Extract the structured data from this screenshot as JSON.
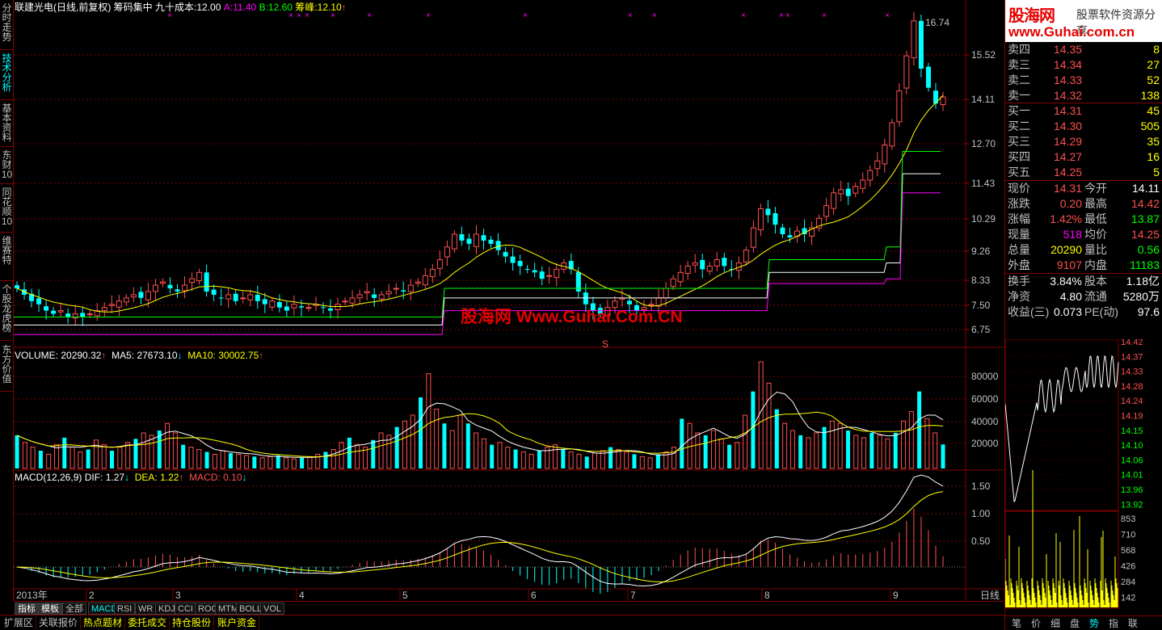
{
  "header": {
    "stock_name": "联建光电(日线,前复权)",
    "indicator_name": "筹码集中",
    "cost90_label": "九十成本:",
    "cost90_value": "12.00",
    "a_label": "A:",
    "a_value": "11.40",
    "b_label": "B:",
    "b_value": "12.60",
    "peak_label": "筹峰:",
    "peak_value": "12.10",
    "peak_arrow": "↑"
  },
  "left_tabs": [
    {
      "label": "分时走势",
      "active": false
    },
    {
      "label": "技术分析",
      "active": true
    },
    {
      "label": "基本资料",
      "active": false
    },
    {
      "label": "东财10",
      "active": false
    },
    {
      "label": "同花顺10",
      "active": false
    },
    {
      "label": "维赛特",
      "active": false
    },
    {
      "label": "个股龙虎榜",
      "active": false
    },
    {
      "label": "东方价值",
      "active": false
    }
  ],
  "price_axis": [
    "15.52",
    "14.11",
    "12.70",
    "11.43",
    "10.29",
    "9.26",
    "8.33",
    "7.50",
    "6.75"
  ],
  "high_label": "16.74",
  "s_marker": "S",
  "volume": {
    "label": "VOLUME:",
    "value": "20290.32",
    "ma5_label": "MA5:",
    "ma5_value": "27673.10",
    "ma10_label": "MA10:",
    "ma10_value": "30002.75",
    "axis": [
      "80000",
      "60000",
      "40000",
      "20000"
    ]
  },
  "macd": {
    "label": "MACD(12,26,9)",
    "dif_label": "DIF:",
    "dif_value": "1.27",
    "dea_label": "DEA:",
    "dea_value": "1.22",
    "macd_label": "MACD:",
    "macd_value": "0.10",
    "axis": [
      "1.50",
      "1.00",
      "0.50"
    ]
  },
  "time_axis": [
    "2013年",
    "2",
    "3",
    "4",
    "5",
    "6",
    "7",
    "8",
    "9"
  ],
  "period_label": "日线",
  "watermark": "股海网 Www.Guhai.Com.CN",
  "logo": {
    "main": "股海网",
    "sub": "股票软件资源分享",
    "url": "www.Guhai.com.cn"
  },
  "order_book": {
    "sells": [
      {
        "label": "卖四",
        "price": "14.35",
        "vol": "8"
      },
      {
        "label": "卖三",
        "price": "14.34",
        "vol": "27"
      },
      {
        "label": "卖二",
        "price": "14.33",
        "vol": "52"
      },
      {
        "label": "卖一",
        "price": "14.32",
        "vol": "138"
      }
    ],
    "buys": [
      {
        "label": "买一",
        "price": "14.31",
        "vol": "45"
      },
      {
        "label": "买二",
        "price": "14.30",
        "vol": "505"
      },
      {
        "label": "买三",
        "price": "14.29",
        "vol": "35"
      },
      {
        "label": "买四",
        "price": "14.27",
        "vol": "16"
      },
      {
        "label": "买五",
        "price": "14.25",
        "vol": "5"
      }
    ]
  },
  "quote": [
    {
      "l1": "现价",
      "v1": "14.31",
      "c1": "#ff5050",
      "l2": "今开",
      "v2": "14.11",
      "c2": "#ffffff"
    },
    {
      "l1": "涨跌",
      "v1": "0.20",
      "c1": "#ff5050",
      "l2": "最高",
      "v2": "14.42",
      "c2": "#ff5050"
    },
    {
      "l1": "涨幅",
      "v1": "1.42%",
      "c1": "#ff5050",
      "l2": "最低",
      "v2": "13.87",
      "c2": "#00ff00"
    },
    {
      "l1": "现量",
      "v1": "518",
      "c1": "#ff00ff",
      "l2": "均价",
      "v2": "14.25",
      "c2": "#ff5050"
    },
    {
      "l1": "总量",
      "v1": "20290",
      "c1": "#ffff00",
      "l2": "量比",
      "v2": "0.56",
      "c2": "#00ff00"
    },
    {
      "l1": "外盘",
      "v1": "9107",
      "c1": "#ff5050",
      "l2": "内盘",
      "v2": "11183",
      "c2": "#00ff00"
    }
  ],
  "quote2": [
    {
      "l1": "换手",
      "v1": "3.84%",
      "l2": "股本",
      "v2": "1.18亿"
    },
    {
      "l1": "净资",
      "v1": "4.80",
      "l2": "流通",
      "v2": "5280万"
    },
    {
      "l1": "收益(三)",
      "v1": "0.073",
      "l2": "PE(动)",
      "v2": "97.6"
    }
  ],
  "mini_axis": [
    "14.42",
    "14.37",
    "14.33",
    "14.28",
    "14.24",
    "14.19",
    "14.15",
    "14.10",
    "14.06",
    "14.01",
    "13.96",
    "13.92"
  ],
  "mini_vol_axis": [
    "853",
    "710",
    "568",
    "426",
    "284",
    "142"
  ],
  "right_tabs": [
    {
      "label": "笔",
      "active": false
    },
    {
      "label": "价",
      "active": false
    },
    {
      "label": "细",
      "active": false
    },
    {
      "label": "盘",
      "active": false
    },
    {
      "label": "势",
      "active": true
    },
    {
      "label": "指",
      "active": false
    },
    {
      "label": "联",
      "active": false
    }
  ],
  "indicator_tabs": [
    {
      "label": "指标",
      "hl": true
    },
    {
      "label": "模板",
      "hl": true
    },
    {
      "label": "全部",
      "hl": false
    },
    {
      "label": "MACD",
      "active": true
    },
    {
      "label": "RSI"
    },
    {
      "label": "WR"
    },
    {
      "label": "KDJ"
    },
    {
      "label": "CCI"
    },
    {
      "label": "ROC"
    },
    {
      "label": "MTM"
    },
    {
      "label": "BOLL"
    },
    {
      "label": "VOL"
    }
  ],
  "function_tabs": [
    {
      "label": "扩展区",
      "first": true
    },
    {
      "label": "关联报价",
      "first": true
    },
    {
      "label": "热点题材"
    },
    {
      "label": "委托成交"
    },
    {
      "label": "持仓股份"
    },
    {
      "label": "账户资金"
    }
  ],
  "colors": {
    "up": "#ff5050",
    "down": "#00ffff",
    "grid": "#800000",
    "ma": "#ffff00"
  },
  "chart_data": {
    "type": "candlestick",
    "title": "联建光电(日线,前复权)",
    "price_ylim": [
      6.5,
      17.0
    ],
    "candles_close": [
      8.3,
      8.1,
      7.9,
      7.8,
      7.6,
      7.5,
      7.6,
      7.4,
      7.5,
      7.4,
      7.5,
      7.6,
      7.7,
      7.8,
      7.9,
      8.0,
      8.1,
      8.0,
      8.2,
      8.4,
      8.5,
      8.3,
      8.2,
      8.4,
      8.6,
      8.8,
      8.2,
      8.1,
      8.0,
      8.1,
      7.9,
      8.0,
      8.1,
      7.9,
      7.8,
      7.9,
      7.7,
      7.6,
      7.8,
      7.7,
      7.7,
      7.8,
      7.7,
      7.6,
      7.8,
      7.9,
      8.0,
      8.1,
      8.2,
      8.0,
      8.1,
      8.2,
      8.3,
      8.2,
      8.4,
      8.5,
      8.7,
      8.9,
      9.2,
      9.6,
      10.0,
      9.8,
      9.7,
      10.0,
      9.8,
      9.7,
      9.5,
      9.3,
      9.1,
      9.0,
      8.9,
      8.8,
      8.6,
      8.7,
      8.9,
      9.1,
      8.9,
      8.2,
      7.8,
      7.6,
      7.5,
      7.7,
      7.9,
      8.0,
      7.8,
      7.6,
      7.7,
      7.8,
      8.0,
      8.3,
      8.6,
      8.8,
      9.0,
      9.1,
      8.9,
      9.0,
      9.2,
      9.0,
      8.9,
      9.1,
      9.5,
      10.2,
      10.8,
      10.6,
      10.3,
      10.0,
      9.9,
      10.1,
      10.0,
      10.2,
      10.5,
      10.9,
      11.3,
      11.4,
      11.2,
      11.5,
      11.7,
      12.0,
      12.3,
      12.8,
      13.5,
      14.5,
      15.6,
      16.7,
      15.2,
      14.6,
      14.1,
      14.31
    ],
    "ma_close_level": [
      7.9,
      8.2,
      8.5,
      9.2,
      9.9,
      10.6,
      11.5,
      12.1
    ],
    "cost90": 12.0,
    "a": 11.4,
    "b": 12.6,
    "peak": 12.1,
    "volume_ylim": [
      0,
      90000
    ],
    "volume_values": [
      28000,
      22000,
      18000,
      15000,
      12000,
      20000,
      26000,
      18000,
      14000,
      16000,
      24000,
      20000,
      15000,
      18000,
      22000,
      25000,
      30000,
      28000,
      32000,
      38000,
      30000,
      20000,
      18000,
      16000,
      14000,
      12000,
      15000,
      13000,
      12000,
      11000,
      10000,
      9000,
      10000,
      11000,
      9000,
      8000,
      9000,
      10000,
      12000,
      14000,
      16000,
      22000,
      26000,
      20000,
      18000,
      24000,
      30000,
      28000,
      35000,
      40000,
      45000,
      60000,
      80000,
      50000,
      38000,
      32000,
      45000,
      38000,
      30000,
      25000,
      20000,
      22000,
      18000,
      16000,
      14000,
      12000,
      15000,
      18000,
      20000,
      16000,
      14000,
      12000,
      10000,
      13000,
      15000,
      18000,
      16000,
      14000,
      12000,
      10000,
      9000,
      12000,
      14000,
      18000,
      42000,
      38000,
      30000,
      28000,
      32000,
      25000,
      20000,
      22000,
      45000,
      65000,
      90000,
      72000,
      50000,
      38000,
      32000,
      28000,
      26000,
      30000,
      35000,
      40000,
      38000,
      32000,
      28000,
      26000,
      30000,
      28000,
      25000,
      30000,
      40000,
      48000,
      65000,
      42000,
      30000,
      20290
    ],
    "macd_ylim": [
      -0.3,
      1.7
    ],
    "macd_dif_last": 1.27,
    "macd_dea_last": 1.22,
    "macd_hist_last": 0.1
  }
}
